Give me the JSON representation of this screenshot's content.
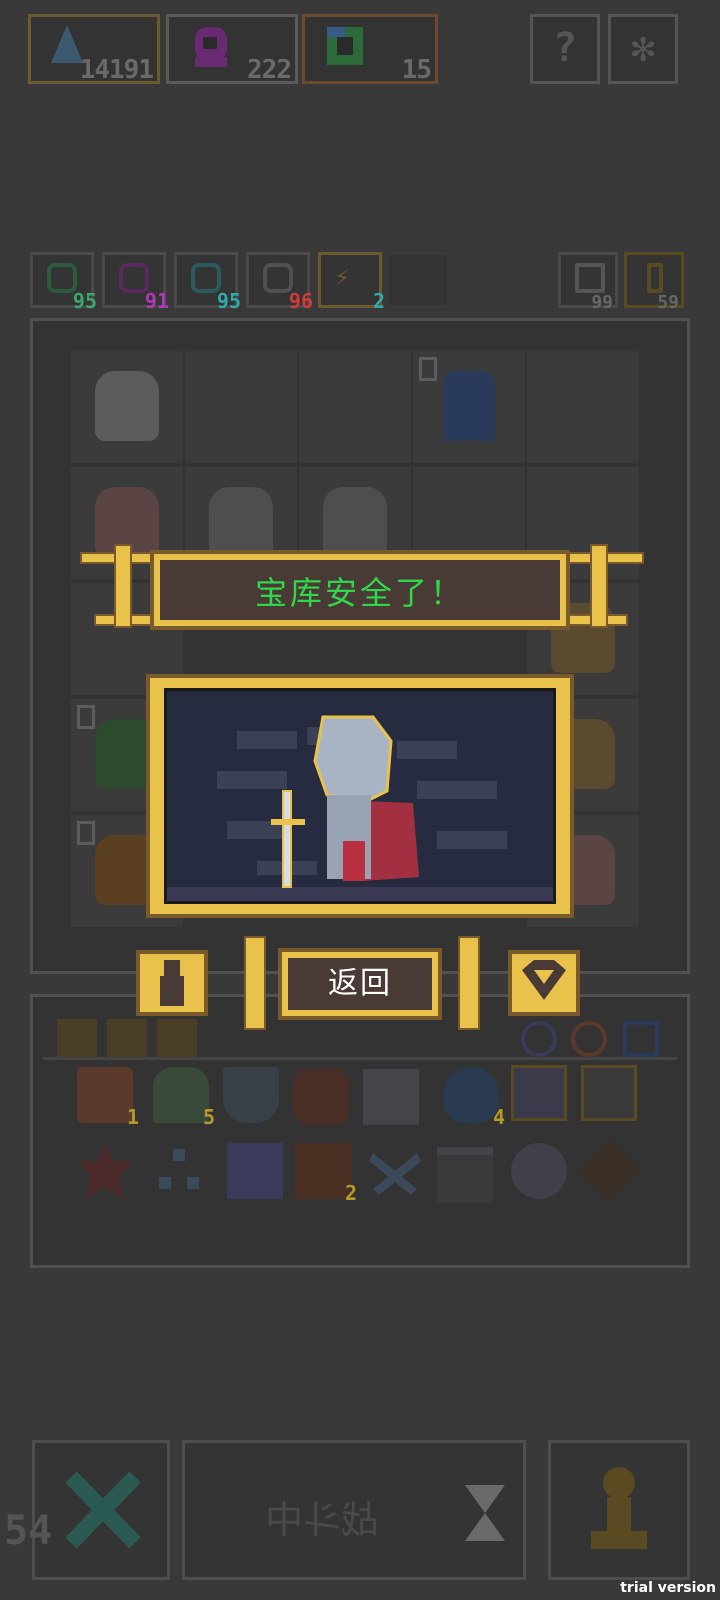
{
  "resources": {
    "mana": "14191",
    "souls": "222",
    "gems": "15"
  },
  "top_buttons": {
    "help": "?",
    "settings": "✻"
  },
  "skills": [
    {
      "count": "95",
      "color": "#3aa76a"
    },
    {
      "count": "91",
      "color": "#b038b8"
    },
    {
      "count": "95",
      "color": "#2fa9a9"
    },
    {
      "count": "96",
      "color": "#d03b3b"
    },
    {
      "count": "2",
      "color": "#2fa9a9"
    }
  ],
  "right_counters": {
    "undo": "99",
    "key": "59"
  },
  "board_badges": [
    "0",
    "0",
    "0"
  ],
  "inventory_quantities": {
    "drum": "1",
    "ghost": "5",
    "water": "4",
    "chest": "2"
  },
  "modal": {
    "banner": "宝库安全了！",
    "back_button": "返回"
  },
  "bottom": {
    "battle_status": "战斗中",
    "fps": "54"
  },
  "watermark": "trial version"
}
